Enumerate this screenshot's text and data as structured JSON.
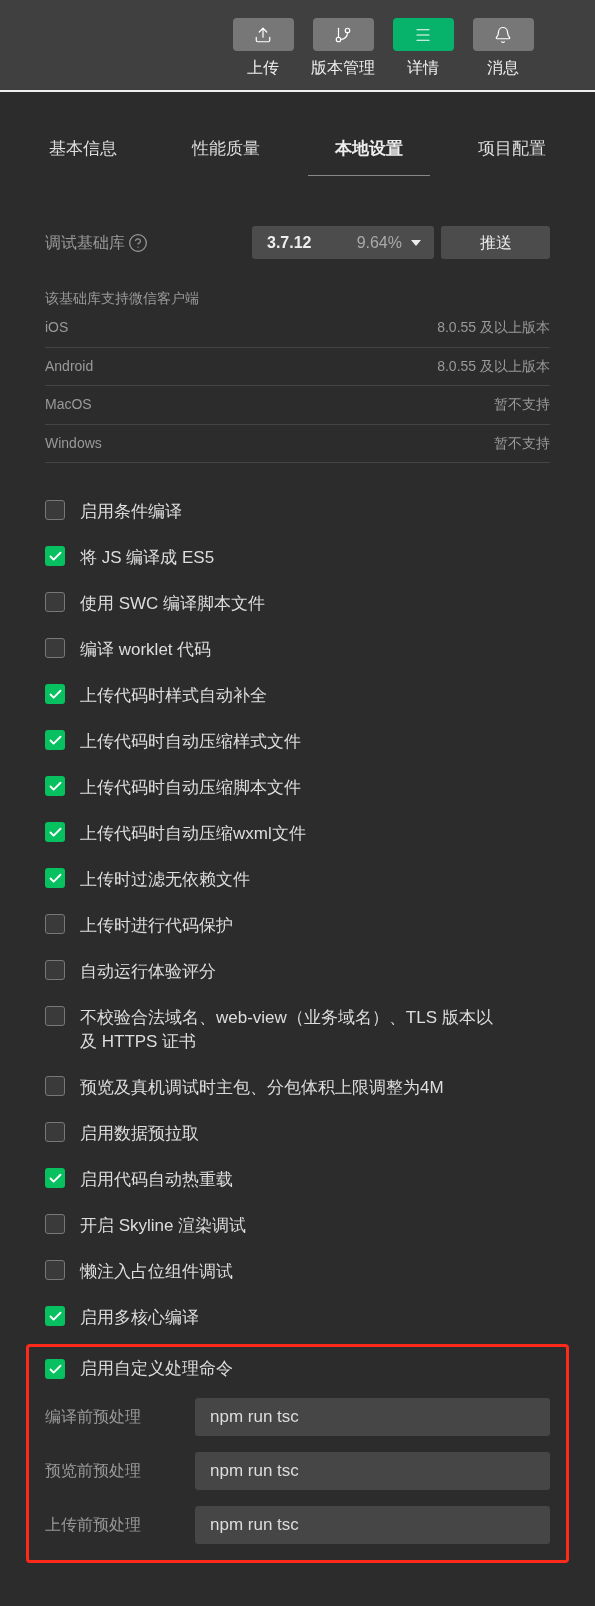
{
  "toolbar": [
    {
      "label": "上传",
      "selected": false
    },
    {
      "label": "版本管理",
      "selected": false
    },
    {
      "label": "详情",
      "selected": true
    },
    {
      "label": "消息",
      "selected": false
    }
  ],
  "tabs": [
    {
      "label": "基本信息",
      "selected": false
    },
    {
      "label": "性能质量",
      "selected": false
    },
    {
      "label": "本地设置",
      "selected": true
    },
    {
      "label": "项目配置",
      "selected": false
    }
  ],
  "base_library": {
    "label": "调试基础库",
    "version": "3.7.12",
    "share": "9.64%",
    "push_button": "推送"
  },
  "client_support": {
    "title": "该基础库支持微信客户端",
    "rows": [
      {
        "platform": "iOS",
        "requirement": "8.0.55 及以上版本"
      },
      {
        "platform": "Android",
        "requirement": "8.0.55 及以上版本"
      },
      {
        "platform": "MacOS",
        "requirement": "暂不支持"
      },
      {
        "platform": "Windows",
        "requirement": "暂不支持"
      }
    ]
  },
  "options": [
    {
      "label": "启用条件编译",
      "checked": false
    },
    {
      "label": "将 JS 编译成 ES5",
      "checked": true
    },
    {
      "label": "使用 SWC 编译脚本文件",
      "checked": false
    },
    {
      "label": "编译 worklet 代码",
      "checked": false
    },
    {
      "label": "上传代码时样式自动补全",
      "checked": true
    },
    {
      "label": "上传代码时自动压缩样式文件",
      "checked": true
    },
    {
      "label": "上传代码时自动压缩脚本文件",
      "checked": true
    },
    {
      "label": "上传代码时自动压缩wxml文件",
      "checked": true
    },
    {
      "label": "上传时过滤无依赖文件",
      "checked": true
    },
    {
      "label": "上传时进行代码保护",
      "checked": false
    },
    {
      "label": "自动运行体验评分",
      "checked": false
    },
    {
      "label": "不校验合法域名、web-view（业务域名）、TLS 版本以及 HTTPS 证书",
      "checked": false
    },
    {
      "label": "预览及真机调试时主包、分包体积上限调整为4M",
      "checked": false
    },
    {
      "label": "启用数据预拉取",
      "checked": false
    },
    {
      "label": "启用代码自动热重载",
      "checked": true
    },
    {
      "label": "开启 Skyline 渲染调试",
      "checked": false
    },
    {
      "label": "懒注入占位组件调试",
      "checked": false
    },
    {
      "label": "启用多核心编译",
      "checked": true
    }
  ],
  "custom_commands": {
    "label": "启用自定义处理命令",
    "checked": true,
    "fields": [
      {
        "label": "编译前预处理",
        "value": "npm run tsc"
      },
      {
        "label": "预览前预处理",
        "value": "npm run tsc"
      },
      {
        "label": "上传前预处理",
        "value": "npm run tsc"
      }
    ]
  }
}
